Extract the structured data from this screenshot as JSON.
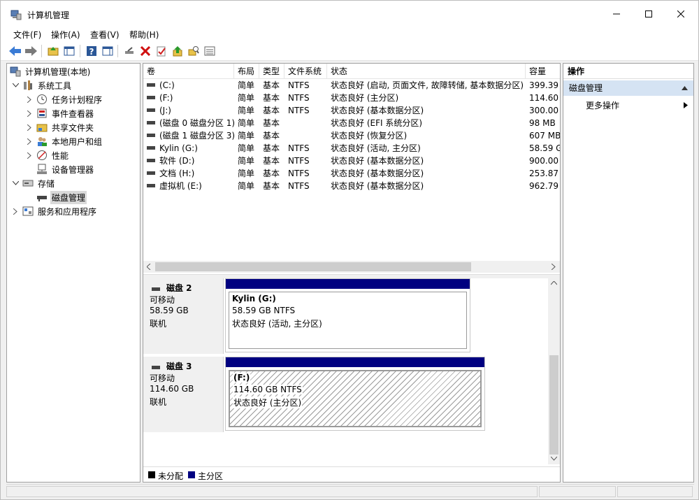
{
  "window": {
    "title": "计算机管理"
  },
  "menu": [
    "文件(F)",
    "操作(A)",
    "查看(V)",
    "帮助(H)"
  ],
  "tree": {
    "root": "计算机管理(本地)",
    "system_tools": "系统工具",
    "task_scheduler": "任务计划程序",
    "event_viewer": "事件查看器",
    "shared_folders": "共享文件夹",
    "local_users": "本地用户和组",
    "performance": "性能",
    "device_manager": "设备管理器",
    "storage": "存储",
    "disk_management": "磁盘管理",
    "services_apps": "服务和应用程序"
  },
  "volume_table": {
    "headers": [
      "卷",
      "布局",
      "类型",
      "文件系统",
      "状态",
      "容量"
    ],
    "rows": [
      {
        "vol": "(C:)",
        "layout": "简单",
        "type": "基本",
        "fs": "NTFS",
        "status": "状态良好 (启动, 页面文件, 故障转储, 基本数据分区)",
        "cap": "399.39"
      },
      {
        "vol": "(F:)",
        "layout": "简单",
        "type": "基本",
        "fs": "NTFS",
        "status": "状态良好 (主分区)",
        "cap": "114.60"
      },
      {
        "vol": "(J:)",
        "layout": "简单",
        "type": "基本",
        "fs": "NTFS",
        "status": "状态良好 (基本数据分区)",
        "cap": "300.00"
      },
      {
        "vol": "(磁盘 0 磁盘分区 1)",
        "layout": "简单",
        "type": "基本",
        "fs": "",
        "status": "状态良好 (EFI 系统分区)",
        "cap": "98 MB"
      },
      {
        "vol": "(磁盘 1 磁盘分区 3)",
        "layout": "简单",
        "type": "基本",
        "fs": "",
        "status": "状态良好 (恢复分区)",
        "cap": "607 MB"
      },
      {
        "vol": "Kylin (G:)",
        "layout": "简单",
        "type": "基本",
        "fs": "NTFS",
        "status": "状态良好 (活动, 主分区)",
        "cap": "58.59 G"
      },
      {
        "vol": "软件 (D:)",
        "layout": "简单",
        "type": "基本",
        "fs": "NTFS",
        "status": "状态良好 (基本数据分区)",
        "cap": "900.00"
      },
      {
        "vol": "文档 (H:)",
        "layout": "简单",
        "type": "基本",
        "fs": "NTFS",
        "status": "状态良好 (基本数据分区)",
        "cap": "253.87"
      },
      {
        "vol": "虚拟机 (E:)",
        "layout": "简单",
        "type": "基本",
        "fs": "NTFS",
        "status": "状态良好 (基本数据分区)",
        "cap": "962.79"
      }
    ]
  },
  "disks": [
    {
      "name": "磁盘 2",
      "kind": "可移动",
      "size": "58.59 GB",
      "state": "联机",
      "partition": {
        "label": "Kylin  (G:)",
        "size": "58.59 GB NTFS",
        "status": "状态良好 (活动, 主分区)"
      }
    },
    {
      "name": "磁盘 3",
      "kind": "可移动",
      "size": "114.60 GB",
      "state": "联机",
      "partition": {
        "label": "(F:)",
        "size": "114.60 GB NTFS",
        "status": "状态良好 (主分区)"
      }
    }
  ],
  "legend": {
    "unallocated": "未分配",
    "primary": "主分区",
    "unallocated_color": "#000000",
    "primary_color": "#000080"
  },
  "actions": {
    "header": "操作",
    "section": "磁盘管理",
    "more": "更多操作"
  }
}
